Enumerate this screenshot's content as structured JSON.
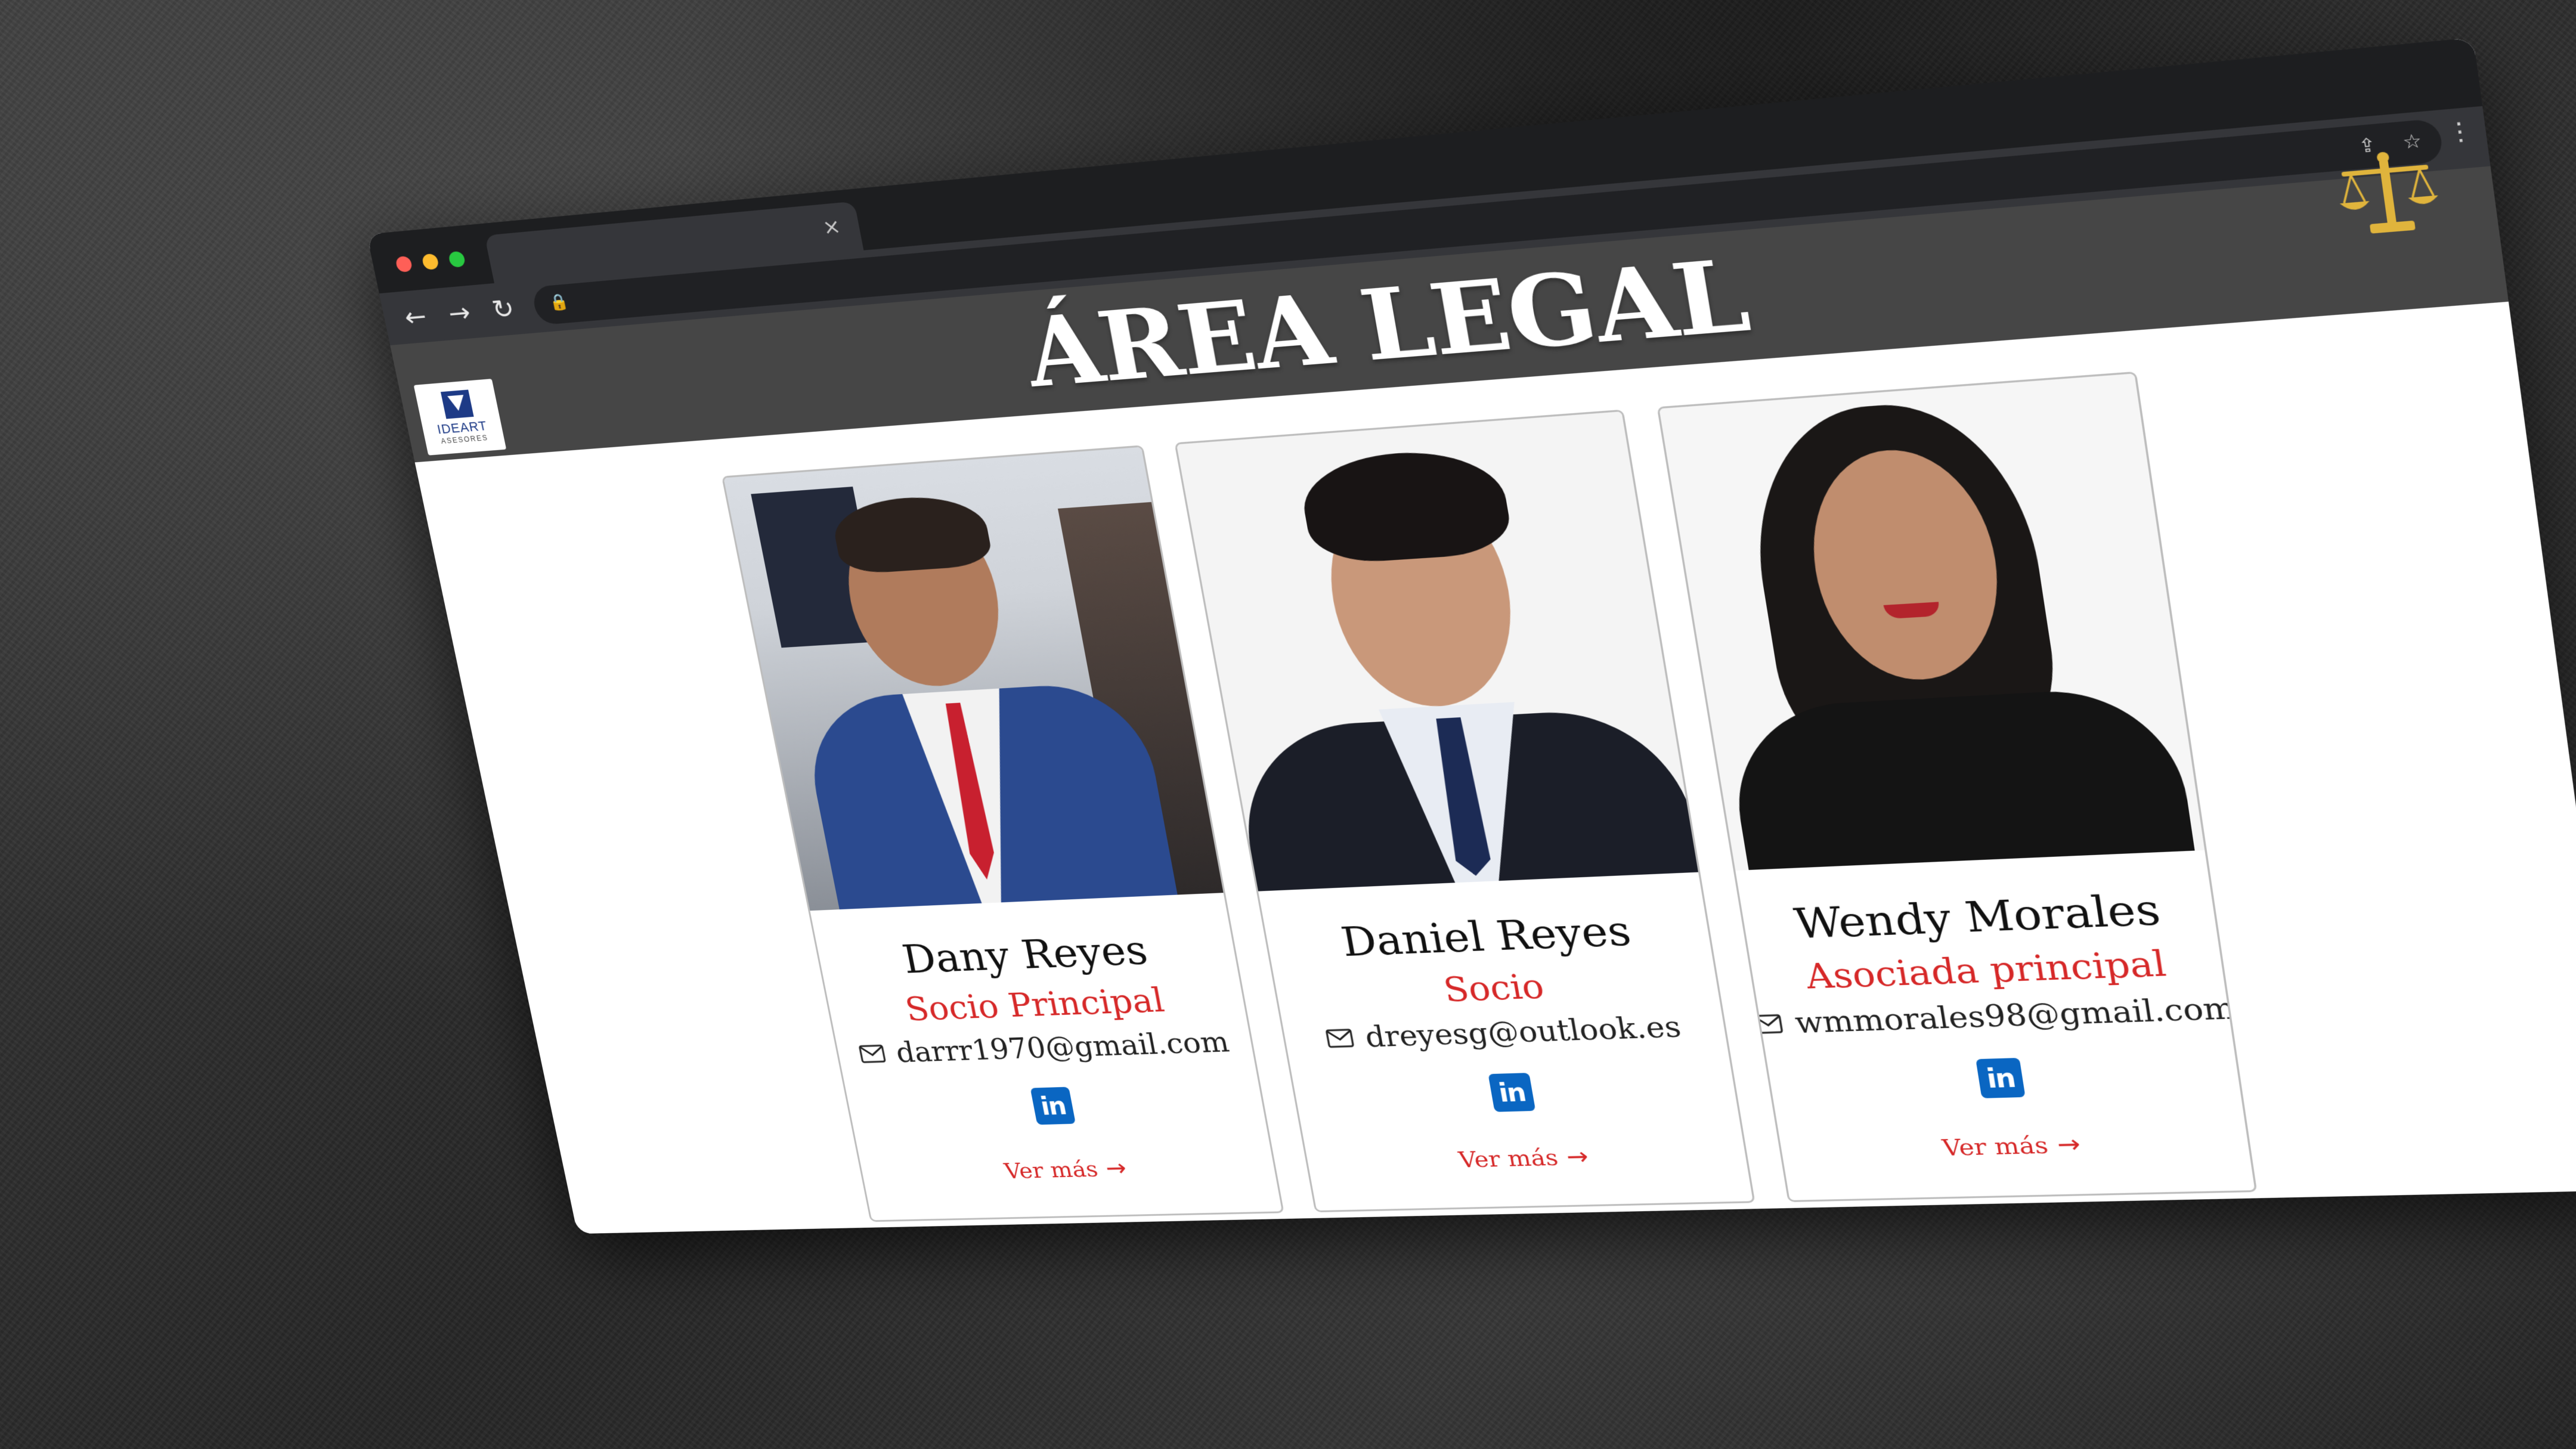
{
  "browser": {
    "tab_close": "×",
    "nav": {
      "back": "←",
      "forward": "→",
      "reload": "↻"
    },
    "lock": "🔒",
    "omnibox_icons": {
      "share": "⇪",
      "bookmark": "☆"
    },
    "menu": "⋮"
  },
  "header": {
    "logo_line1": "IDEART",
    "logo_line2": "ASESORES",
    "title": "ÁREA LEGAL",
    "scales_icon": "scales-of-justice-icon"
  },
  "team": [
    {
      "name": "Dany Reyes",
      "role": "Socio Principal",
      "email": "darrr1970@gmail.com",
      "linkedin": "in",
      "more": "Ver más",
      "arrow": "→"
    },
    {
      "name": "Daniel Reyes",
      "role": "Socio",
      "email": "dreyesg@outlook.es",
      "linkedin": "in",
      "more": "Ver más",
      "arrow": "→"
    },
    {
      "name": "Wendy Morales",
      "role": "Asociada principal",
      "email": "wmmorales98@gmail.com",
      "linkedin": "in",
      "more": "Ver más",
      "arrow": "→"
    }
  ],
  "colors": {
    "accent_red": "#d62828",
    "header_bg": "#464646",
    "linkedin_blue": "#0a66c2",
    "gold": "#e0b43c"
  }
}
